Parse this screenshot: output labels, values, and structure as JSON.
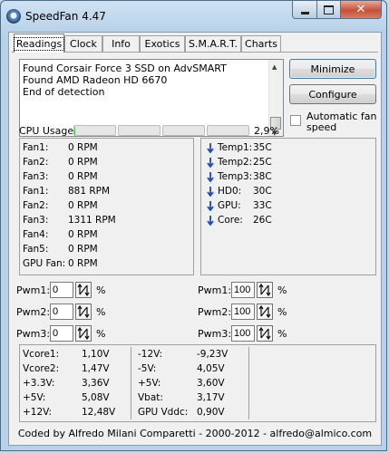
{
  "window": {
    "title": "SpeedFan 4.47"
  },
  "tabs": [
    {
      "label": "Readings",
      "active": true
    },
    {
      "label": "Clock"
    },
    {
      "label": "Info"
    },
    {
      "label": "Exotics"
    },
    {
      "label": "S.M.A.R.T."
    },
    {
      "label": "Charts"
    }
  ],
  "log": {
    "lines": [
      "Found Corsair Force 3 SSD on AdvSMART",
      "Found AMD Radeon HD 6670",
      "End of detection"
    ]
  },
  "buttons": {
    "minimize": "Minimize",
    "configure": "Configure"
  },
  "auto_fan": {
    "label": "Automatic fan speed",
    "checked": false
  },
  "cpu": {
    "label": "CPU Usage",
    "percent": "2,9%",
    "bars": [
      0.03,
      0,
      0,
      0
    ]
  },
  "fans": [
    {
      "name": "Fan1:",
      "value": "0 RPM"
    },
    {
      "name": "Fan2:",
      "value": "0 RPM"
    },
    {
      "name": "Fan3:",
      "value": "0 RPM"
    },
    {
      "name": "Fan1:",
      "value": "881 RPM"
    },
    {
      "name": "Fan2:",
      "value": "0 RPM"
    },
    {
      "name": "Fan3:",
      "value": "1311 RPM"
    },
    {
      "name": "Fan4:",
      "value": "0 RPM"
    },
    {
      "name": "Fan5:",
      "value": "0 RPM"
    },
    {
      "name": "GPU Fan:",
      "value": "0 RPM"
    }
  ],
  "temps": [
    {
      "name": "Temp1:",
      "value": "35C",
      "icon": "arrow-down-icon"
    },
    {
      "name": "Temp2:",
      "value": "25C",
      "icon": "arrow-down-icon"
    },
    {
      "name": "Temp3:",
      "value": "38C",
      "icon": "arrow-down-icon"
    },
    {
      "name": "HD0:",
      "value": "30C",
      "icon": "arrow-down-icon"
    },
    {
      "name": "GPU:",
      "value": "33C",
      "icon": "arrow-down-icon"
    },
    {
      "name": "Core:",
      "value": "26C",
      "icon": "arrow-down-icon"
    }
  ],
  "pwm_left": [
    {
      "label": "Pwm1:",
      "value": "0",
      "unit": "%"
    },
    {
      "label": "Pwm2:",
      "value": "0",
      "unit": "%"
    },
    {
      "label": "Pwm3:",
      "value": "0",
      "unit": "%"
    }
  ],
  "pwm_right": [
    {
      "label": "Pwm1:",
      "value": "100",
      "unit": "%"
    },
    {
      "label": "Pwm2:",
      "value": "100",
      "unit": "%"
    },
    {
      "label": "Pwm3:",
      "value": "100",
      "unit": "%"
    }
  ],
  "voltages_col1": [
    {
      "name": "Vcore1:",
      "value": "1,10V"
    },
    {
      "name": "Vcore2:",
      "value": "1,47V"
    },
    {
      "name": "+3.3V:",
      "value": "3,36V"
    },
    {
      "name": "+5V:",
      "value": "5,08V"
    },
    {
      "name": "+12V:",
      "value": "12,48V"
    }
  ],
  "voltages_col2": [
    {
      "name": "-12V:",
      "value": "-9,23V"
    },
    {
      "name": "-5V:",
      "value": "4,05V"
    },
    {
      "name": "+5V:",
      "value": "3,60V"
    },
    {
      "name": "Vbat:",
      "value": "3,17V"
    },
    {
      "name": "GPU Vddc:",
      "value": "0,90V"
    }
  ],
  "footer": "Coded by Alfredo Milani Comparetti - 2000-2012 - alfredo@almico.com",
  "colors": {
    "arrow": "#1a4bb3",
    "cpu_fill": "#29b729"
  }
}
